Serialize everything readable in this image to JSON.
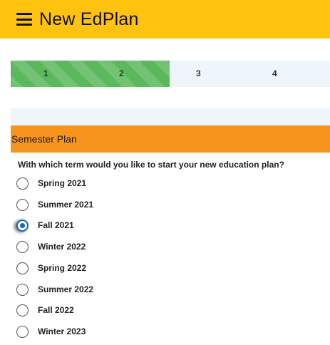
{
  "header": {
    "title": "New EdPlan",
    "menu_icon": "hamburger-menu-icon",
    "color": "#ffc20e"
  },
  "progress": {
    "steps": [
      "1",
      "2",
      "3",
      "4"
    ],
    "completed_steps": 2,
    "done_color": "#5cb85c"
  },
  "semester_plan": {
    "heading": "Semester Plan",
    "heading_color": "#f7941d",
    "question": "With which term would you like to start your new education plan?",
    "options": [
      "Spring 2021",
      "Summer 2021",
      "Fall 2021",
      "Winter 2022",
      "Spring 2022",
      "Summer 2022",
      "Fall 2022",
      "Winter 2023"
    ],
    "selected": "Fall 2021"
  }
}
